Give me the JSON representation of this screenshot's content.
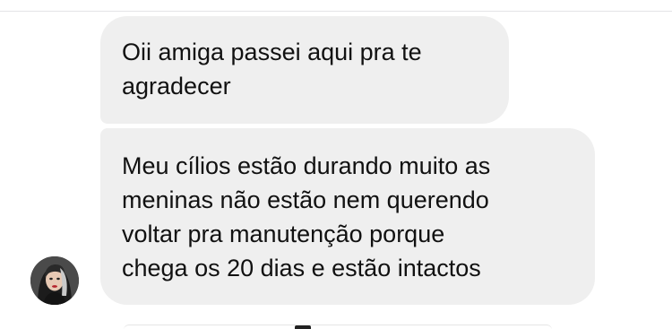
{
  "conversation": {
    "messages": [
      {
        "sender": "contact",
        "lines": [
          "Oii amiga passei aqui pra te",
          "agradecer"
        ]
      },
      {
        "sender": "contact",
        "lines": [
          "Meu cílios estão durando muito as",
          "meninas não estão nem querendo",
          "voltar pra manutenção porque",
          "chega os 20 dias e estão intactos"
        ]
      }
    ],
    "avatar": {
      "icon": "contact-avatar-photo"
    }
  },
  "colors": {
    "background": "#ffffff",
    "bubble": "#efefef",
    "text": "#111111"
  }
}
